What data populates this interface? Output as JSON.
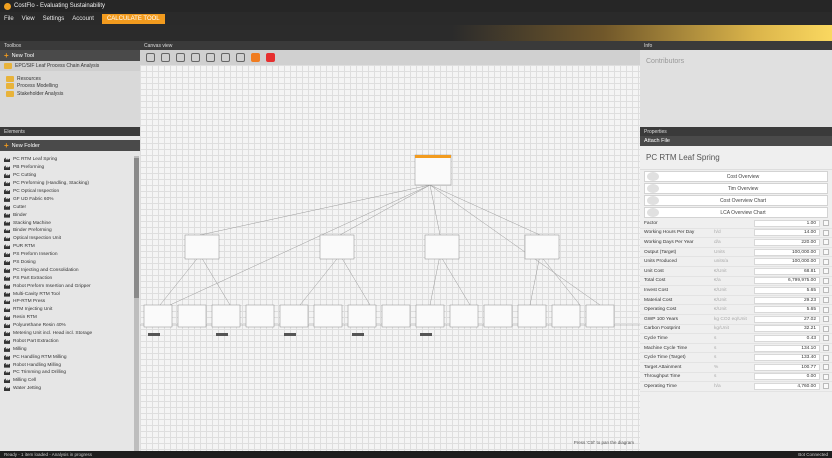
{
  "app": {
    "title": "CostFlo - Evaluating Sustainability"
  },
  "menu": {
    "items": [
      "File",
      "View",
      "Settings",
      "Account"
    ],
    "active_tab": "CALCULATE TOOL"
  },
  "tools_panel": {
    "header": "Toolbox",
    "new_tool_label": "New Tool",
    "selected_tool": "EPC/SIF Leaf Process Chain Analysis",
    "tree_items": [
      "Resources",
      "Process Modelling",
      "Stakeholder Analysis"
    ]
  },
  "elements_panel": {
    "header": "Elements",
    "new_folder_label": "New Folder",
    "items": [
      "PC RTM Leaf Spring",
      "PB Preforming",
      "PC Cutting",
      "PC Preforming (Handling, Stacking)",
      "PC Optical Inspection",
      "GF UD Fabric 60%",
      "Cutter",
      "Binder",
      "Stacking Machine",
      "Binder Preforming",
      "Optical Inspection Unit",
      "PUR RTM",
      "PS Preform Insertion",
      "PS Dosing",
      "PC Injecting and Consolidation",
      "PS Part Extraction",
      "Robot Preform Insertion and Gripper",
      "Multi-Cavity RTM Tool",
      "HP-RTM Press",
      "RTM Injecting Unit",
      "Resin RTM",
      "Polyurethane Resin 40%",
      "Metering Unit incl. Head incl. Storage",
      "Robot Part Extraction",
      "Milling",
      "PC Handling RTM Milling",
      "Robot Handling Milling",
      "PC Trimming and Drilling",
      "Milling Cell",
      "Water Jetting"
    ]
  },
  "canvas": {
    "tab_label": "Canvas view",
    "hint": "Press 'Ctrl' to pan the diagram"
  },
  "info_panel": {
    "header": "Info",
    "contributors_label": "Contributors"
  },
  "properties_panel": {
    "header": "Properties",
    "attach_label": "Attach File",
    "title": "PC RTM Leaf Spring",
    "buttons": [
      "Cost Overview",
      "Tim Overview",
      "Cost Overview Chart",
      "LCA Overview Chart"
    ],
    "rows": [
      {
        "name": "Factor",
        "unit": "",
        "value": "1.00"
      },
      {
        "name": "Working Hours Per Day",
        "unit": "h/d",
        "value": "14.00"
      },
      {
        "name": "Working Days Per Year",
        "unit": "d/a",
        "value": "220.00"
      },
      {
        "name": "Output (Target)",
        "unit": "Units",
        "value": "100,000.00"
      },
      {
        "name": "Units Produced",
        "unit": "units/a",
        "value": "100,000.00"
      },
      {
        "name": "Unit Cost",
        "unit": "€/Unit",
        "value": "68.81"
      },
      {
        "name": "Total Cost",
        "unit": "€/a",
        "value": "6,799,975.00"
      },
      {
        "name": "Invest Cost",
        "unit": "€/Unit",
        "value": "5.65"
      },
      {
        "name": "Material Cost",
        "unit": "€/Unit",
        "value": "29.23"
      },
      {
        "name": "Operating Cost",
        "unit": "€/Unit",
        "value": "5.65"
      },
      {
        "name": "GWP 100 Years",
        "unit": "kg CO2 eq/Unit",
        "value": "27.02"
      },
      {
        "name": "Carbon Footprint",
        "unit": "kg/Unit",
        "value": "32.21"
      },
      {
        "name": "Cycle Time",
        "unit": "s",
        "value": "0.43"
      },
      {
        "name": "Machine Cycle Time",
        "unit": "s",
        "value": "134.10"
      },
      {
        "name": "Cycle Time (Target)",
        "unit": "s",
        "value": "133.40"
      },
      {
        "name": "Target Attainment",
        "unit": "%",
        "value": "100.77"
      },
      {
        "name": "Throughput Time",
        "unit": "s",
        "value": "0.00"
      },
      {
        "name": "Operating Time",
        "unit": "h/a",
        "value": "4,760.00"
      }
    ]
  },
  "status": {
    "left": "Ready - 1 item loaded - Analysis in progress",
    "right": "Bot Connected"
  }
}
